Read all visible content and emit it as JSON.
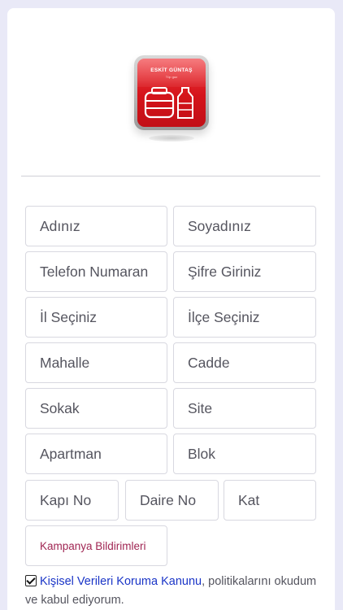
{
  "logo": {
    "title": "ESKİT GÜNTAŞ",
    "subtitle": "Tüp gaz"
  },
  "form": {
    "first_name": "Adınız",
    "last_name": "Soyadınız",
    "phone": "Telefon Numaran",
    "password": "Şifre Giriniz",
    "province": "İl Seçiniz",
    "district": "İlçe Seçiniz",
    "neighborhood": "Mahalle",
    "street": "Cadde",
    "alley": "Sokak",
    "site": "Site",
    "apartment": "Apartman",
    "block": "Blok",
    "door_no": "Kapı No",
    "flat_no": "Daire No",
    "floor": "Kat",
    "campaign_notifications": "Kampanya Bildirimleri"
  },
  "consent": {
    "checked": true,
    "link_text": "Kişisel Verileri Koruma Kanunu",
    "text": ", politikalarını okudum ve kabul ediyorum."
  },
  "colors": {
    "background": "#e9e9f7",
    "link": "#1a35c7",
    "campaign_text": "#a02653",
    "logo_red": "#d4141b"
  }
}
